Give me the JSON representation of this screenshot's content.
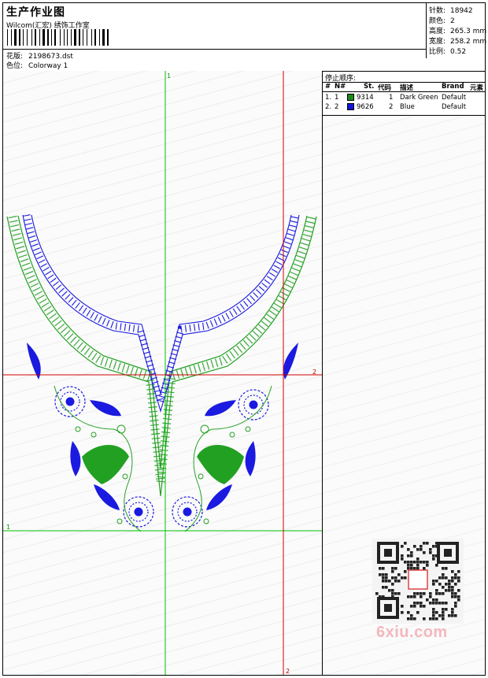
{
  "header": {
    "title": "生产作业图",
    "company": "Wilcom(汇宏) 绣饰工作室",
    "design_label": "花版:",
    "design_file": "2198673.dst",
    "colorway_label": "色位:",
    "colorway": "Colorway 1"
  },
  "stats": [
    {
      "label": "针数:",
      "value": "18942"
    },
    {
      "label": "颜色:",
      "value": "2"
    },
    {
      "label": "高度:",
      "value": "265.3 mm"
    },
    {
      "label": "宽度:",
      "value": "258.2 mm"
    },
    {
      "label": "比例:",
      "value": "0.52"
    }
  ],
  "stop_sequence": {
    "title": "停止顺序:",
    "columns": [
      "#",
      "N#",
      "St.",
      "代码",
      "描述",
      "Brand",
      "元素"
    ],
    "rows": [
      {
        "seq": "1.",
        "n": "1",
        "st": "9314",
        "code": "1",
        "desc": "Dark Green",
        "brand": "Default",
        "color": "#1a8a1a"
      },
      {
        "seq": "2.",
        "n": "2",
        "st": "9626",
        "code": "2",
        "desc": "Blue",
        "brand": "Default",
        "color": "#1414d8"
      }
    ]
  },
  "guides": {
    "v1_label": "1",
    "h1_label": "1",
    "h2_label": "2",
    "v2_label": "2"
  },
  "watermark": "6xiu.com",
  "colors": {
    "green_thread": "#22a022",
    "blue_thread": "#1a1ae0",
    "guide_green": "#00c000",
    "guide_red": "#d00000"
  }
}
